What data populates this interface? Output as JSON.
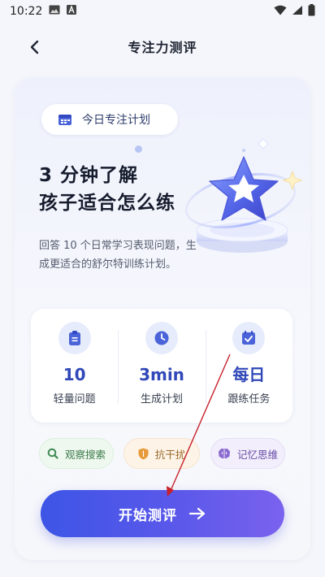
{
  "status_bar": {
    "time": "10:22"
  },
  "top_bar": {
    "title": "专注力测评"
  },
  "card": {
    "plan_chip_label": "今日专注计划",
    "headline_line1": "3 分钟了解",
    "headline_line2": "孩子适合怎么练",
    "description": "回答 10 个日常学习表现问题，生成更适合的舒尔特训练计划。",
    "stats": [
      {
        "value": "10",
        "label": "轻量问题"
      },
      {
        "value": "3min",
        "label": "生成计划"
      },
      {
        "value": "每日",
        "label": "跟练任务"
      }
    ],
    "tags": [
      {
        "label": "观察搜索"
      },
      {
        "label": "抗干扰"
      },
      {
        "label": "记忆思维"
      }
    ],
    "start_button_label": "开始测评"
  },
  "colors": {
    "accent": "#3d55e6",
    "stat_value": "#3148b8",
    "annotation_arrow": "#c8202a"
  }
}
